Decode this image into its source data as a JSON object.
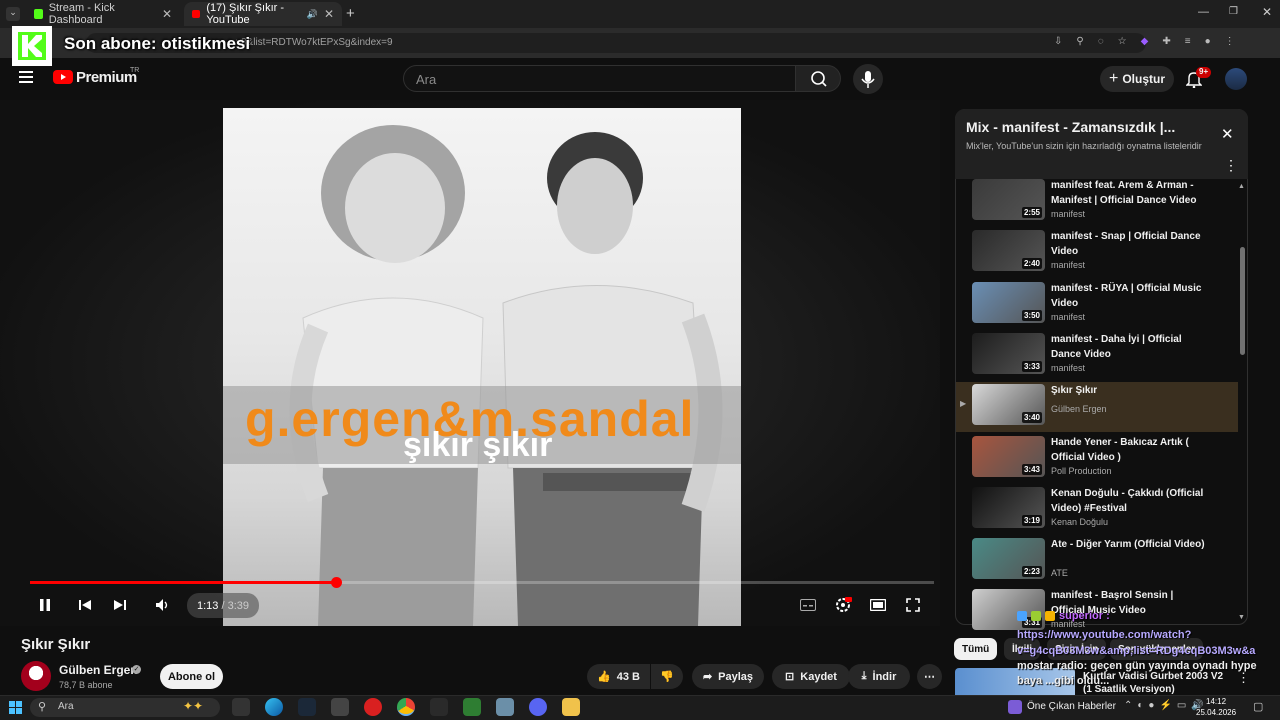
{
  "browser": {
    "tabs": [
      {
        "title": "Stream - Kick Dashboard"
      },
      {
        "title": "(17) Şıkır Şıkır - YouTube"
      }
    ],
    "new_tab": "+",
    "url": "v8&list=RDTWo7ktEPxSg&index=9"
  },
  "youtube": {
    "logo": "Premium",
    "region": "TR",
    "search_placeholder": "Ara",
    "create_label": "Oluştur",
    "notif_count": "9+"
  },
  "player": {
    "cover_artist": "g.ergen&m.sandal",
    "cover_song": "şıkır şıkır",
    "current_time": "1:13",
    "separator": "/",
    "duration": "3:39",
    "progress": 0.338
  },
  "video": {
    "title": "Şıkır Şıkır",
    "channel": "Gülben Ergen",
    "subscribers": "78,7 B abone",
    "subscribe_label": "Abone ol",
    "likes": "43 B",
    "share_label": "Paylaş",
    "save_label": "Kaydet",
    "download_label": "İndir"
  },
  "playlist": {
    "title": "Mix - manifest - Zamansızdık |...",
    "subtitle": "Mix'ler, YouTube'un sizin için hazırladığı oynatma listeleridir",
    "items": [
      {
        "title": "manifest feat. Arem & Arman - Manifest | Official Dance Video",
        "channel": "manifest",
        "duration": "2:55",
        "color": "#3a3a3a"
      },
      {
        "title": "manifest - Snap | Official Dance Video",
        "channel": "manifest",
        "duration": "2:40",
        "color": "#2a2a2a"
      },
      {
        "title": "manifest - RÜYA | Official Music Video",
        "channel": "manifest",
        "duration": "3:50",
        "color": "#6a8fb5"
      },
      {
        "title": "manifest - Daha İyi | Official Dance Video",
        "channel": "manifest",
        "duration": "3:33",
        "color": "#1d1d1d"
      },
      {
        "title": "Şıkır Şıkır",
        "channel": "Gülben Ergen",
        "duration": "3:40",
        "color": "#d9d9d9"
      },
      {
        "title": "Hande Yener - Bakıcaz Artık ( Official Video )",
        "channel": "Poll Production",
        "duration": "3:43",
        "color": "#a8553e"
      },
      {
        "title": "Kenan Doğulu - Çakkıdı (Official Video) #Festival",
        "channel": "Kenan Doğulu",
        "duration": "3:19",
        "color": "#111111"
      },
      {
        "title": "Ate - Diğer Yarım (Official Video)",
        "channel": "ATE",
        "duration": "2:23",
        "color": "#4a8a86"
      },
      {
        "title": "manifest - Başrol Sensin | Official Music Video",
        "channel": "manifest",
        "duration": "3:31",
        "color": "#cfcfcf"
      }
    ],
    "playing_marker": "▶"
  },
  "chips": {
    "all": "Tümü",
    "related": "İlgili",
    "other": "Sizin İçin",
    "recent": "Son yüklenenler"
  },
  "next_video": {
    "title": "Kurtlar Vadisi Gurbet 2003 V2 (1 Saatlik Versiyon)"
  },
  "overlay": {
    "son_abone": "Son abone: otistikmesi",
    "chat_user": "superior :",
    "chat_link": "https://www.youtube.com/watch?",
    "chat_link2": "v=g4cqB03M3w&amp;list=RDg4cqB03M3w&a",
    "chat_msg": "mostar radio: geçen gün yayında oynadı hype",
    "chat_msg2": "baya ...gibi oldu..."
  },
  "taskbar": {
    "search": "Ara",
    "news": "Öne Çıkan Haberler",
    "time": "14:12",
    "date": "25.04.2026"
  }
}
